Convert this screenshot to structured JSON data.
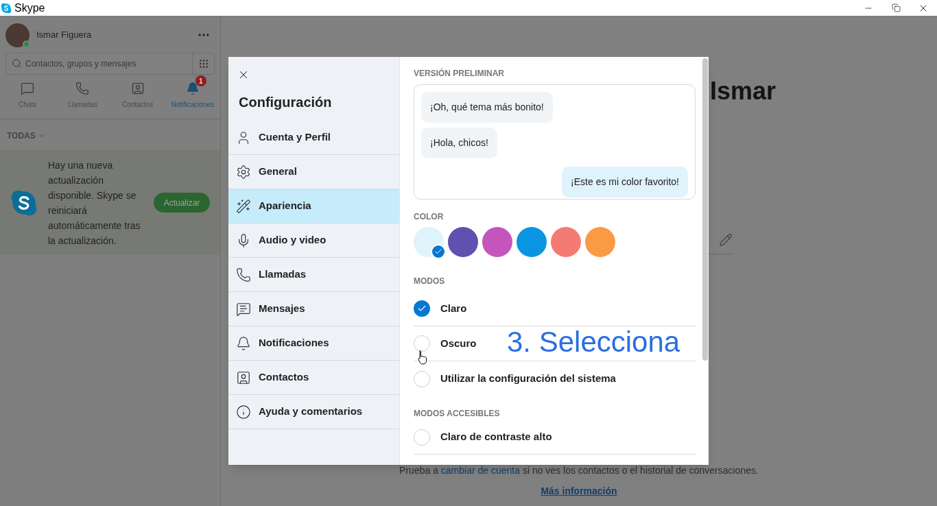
{
  "window": {
    "title": "Skype"
  },
  "sidebar": {
    "profile_name": "Ismar Figuera",
    "search": {
      "placeholder": "Contactos, grupos y mensajes"
    },
    "tabs": [
      {
        "label": "Chats",
        "selected": false
      },
      {
        "label": "Llamadas",
        "selected": false
      },
      {
        "label": "Contactos",
        "selected": false
      },
      {
        "label": "Notificaciones",
        "selected": true,
        "badge": "1"
      }
    ],
    "filter": "TODAS",
    "notification": {
      "text": "Hay una nueva actualización disponible. Skype se reiniciará automáticamente tras la actualización.",
      "button": "Actualizar"
    }
  },
  "main": {
    "heading": "Ismar",
    "hint_before": "Prueba a",
    "hint_link": "cambiar de cuenta",
    "hint_after": "si no ves los contactos o el historial de conversaciones.",
    "more_link": "Más información"
  },
  "settings": {
    "title": "Configuración",
    "nav": [
      {
        "label": "Cuenta y Perfil",
        "selected": false
      },
      {
        "label": "General",
        "selected": false
      },
      {
        "label": "Apariencia",
        "selected": true
      },
      {
        "label": "Audio y video",
        "selected": false
      },
      {
        "label": "Llamadas",
        "selected": false
      },
      {
        "label": "Mensajes",
        "selected": false
      },
      {
        "label": "Notificaciones",
        "selected": false
      },
      {
        "label": "Contactos",
        "selected": false
      },
      {
        "label": "Ayuda y comentarios",
        "selected": false
      }
    ],
    "preview_label": "VERSIÓN PRELIMINAR",
    "preview_messages": [
      {
        "text": "¡Oh, qué tema más bonito!",
        "kind": "incoming"
      },
      {
        "text": "¡Hola, chicos!",
        "kind": "incoming"
      },
      {
        "text": "¡Este es mi color favorito!",
        "kind": "outgoing"
      }
    ],
    "color_label": "COLOR",
    "colors": [
      {
        "color": "#dff3fd",
        "selected": true
      },
      {
        "color": "#5f51b0",
        "selected": false
      },
      {
        "color": "#c455bc",
        "selected": false
      },
      {
        "color": "#0a95e2",
        "selected": false
      },
      {
        "color": "#f47b73",
        "selected": false
      },
      {
        "color": "#fb9a45",
        "selected": false
      }
    ],
    "modes_label": "MODOS",
    "modes": [
      {
        "label": "Claro",
        "checked": true
      },
      {
        "label": "Oscuro",
        "checked": false
      },
      {
        "label": "Utilizar la configuración del sistema",
        "checked": false
      }
    ],
    "accessible_label": "MODOS ACCESIBLES",
    "accessible_modes": [
      {
        "label": "Claro de contraste alto",
        "checked": false
      }
    ]
  },
  "annotation": "3. Selecciona"
}
